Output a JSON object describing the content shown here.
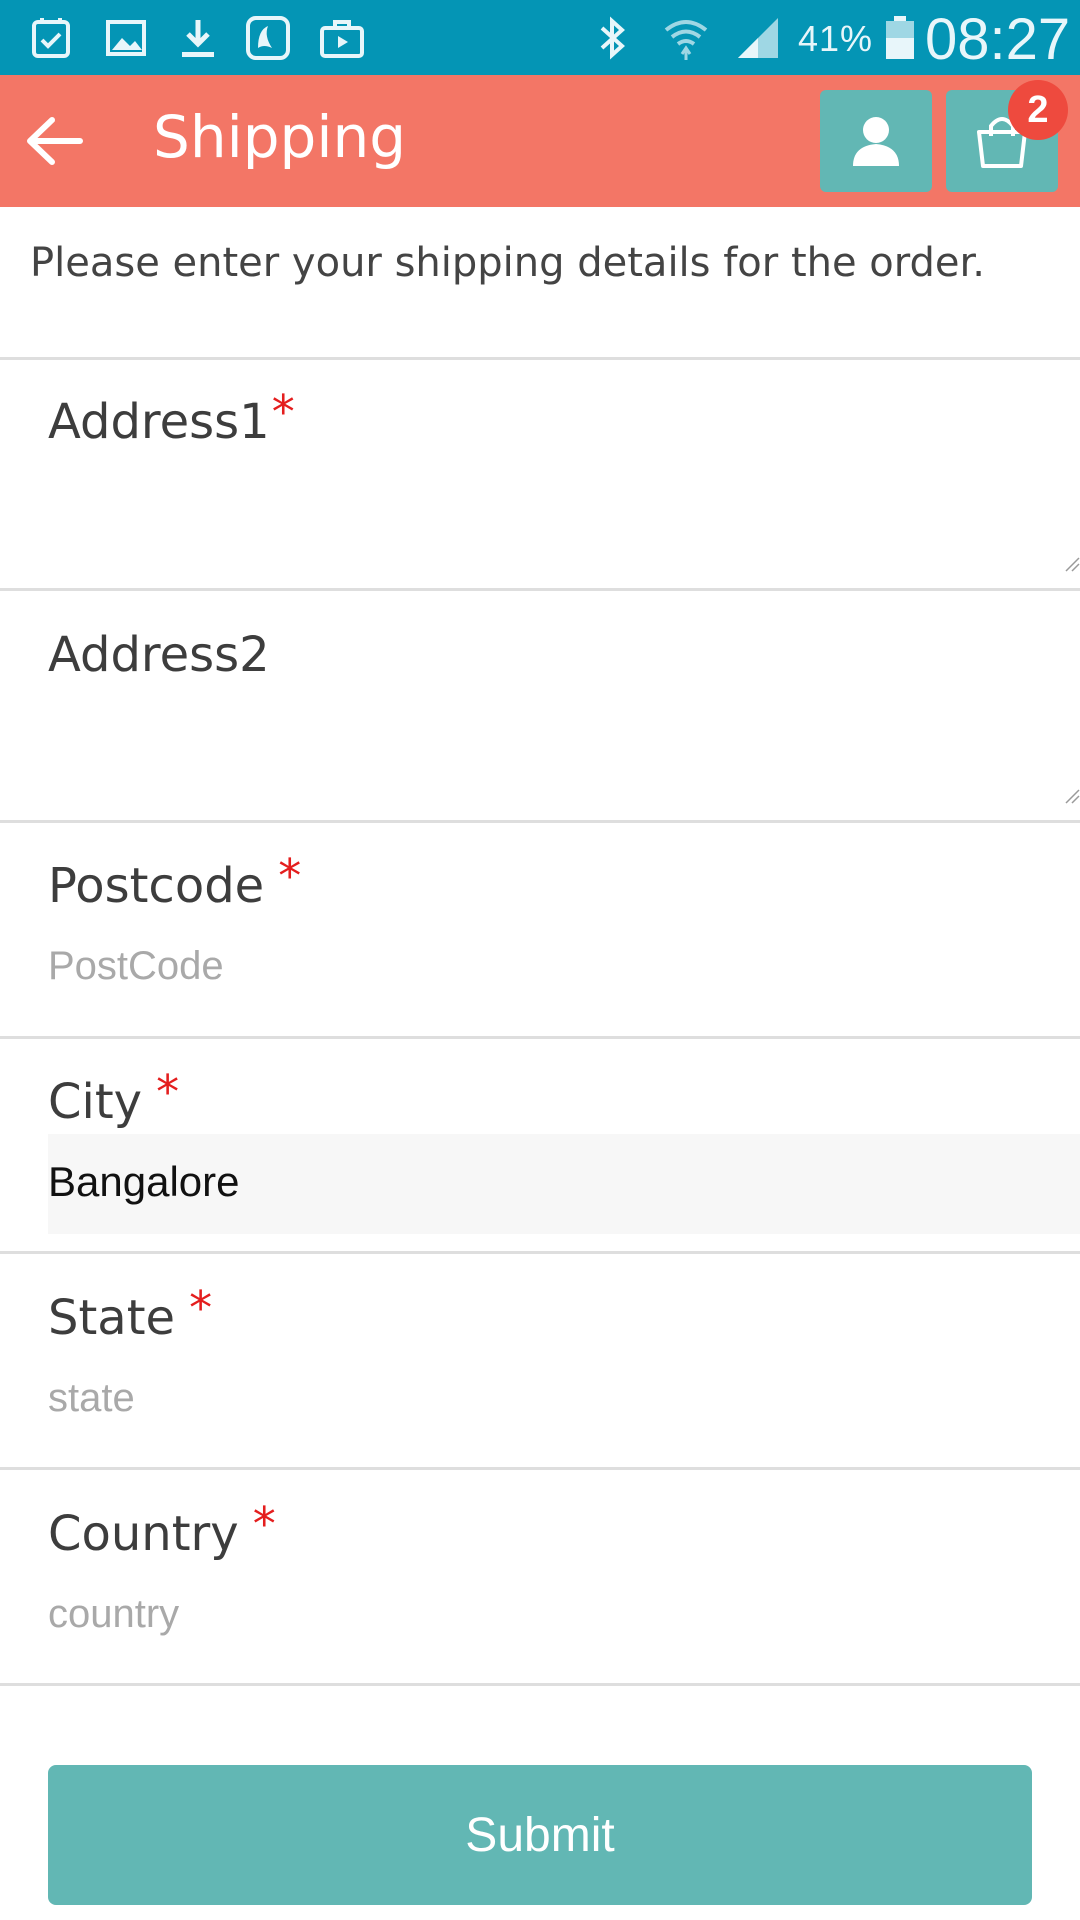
{
  "status_bar": {
    "battery": "41%",
    "time": "08:27",
    "icons": [
      "shopping-notification-icon",
      "gallery-icon",
      "download-icon",
      "music-app-icon",
      "briefcase-icon",
      "bluetooth-icon",
      "wifi-icon",
      "signal-icon",
      "battery-icon"
    ]
  },
  "header": {
    "title": "Shipping",
    "cart_count": "2",
    "color": "#f37666",
    "button_color": "#62b7b4"
  },
  "intro": "Please enter your shipping details for the order.",
  "form": {
    "address1": {
      "label": "Address1",
      "required": "*"
    },
    "address2": {
      "label": "Address2"
    },
    "postcode": {
      "label": "Postcode",
      "required": "*",
      "placeholder": "PostCode"
    },
    "city": {
      "label": "City",
      "required": "*",
      "value": "Bangalore"
    },
    "state": {
      "label": "State",
      "required": "*",
      "placeholder": "state"
    },
    "country": {
      "label": "Country",
      "required": "*",
      "placeholder": "country"
    }
  },
  "submit_label": "Submit",
  "colors": {
    "status_bar": "#0495b5",
    "required_marker": "#e41e1e",
    "badge": "#ee4a3e"
  }
}
